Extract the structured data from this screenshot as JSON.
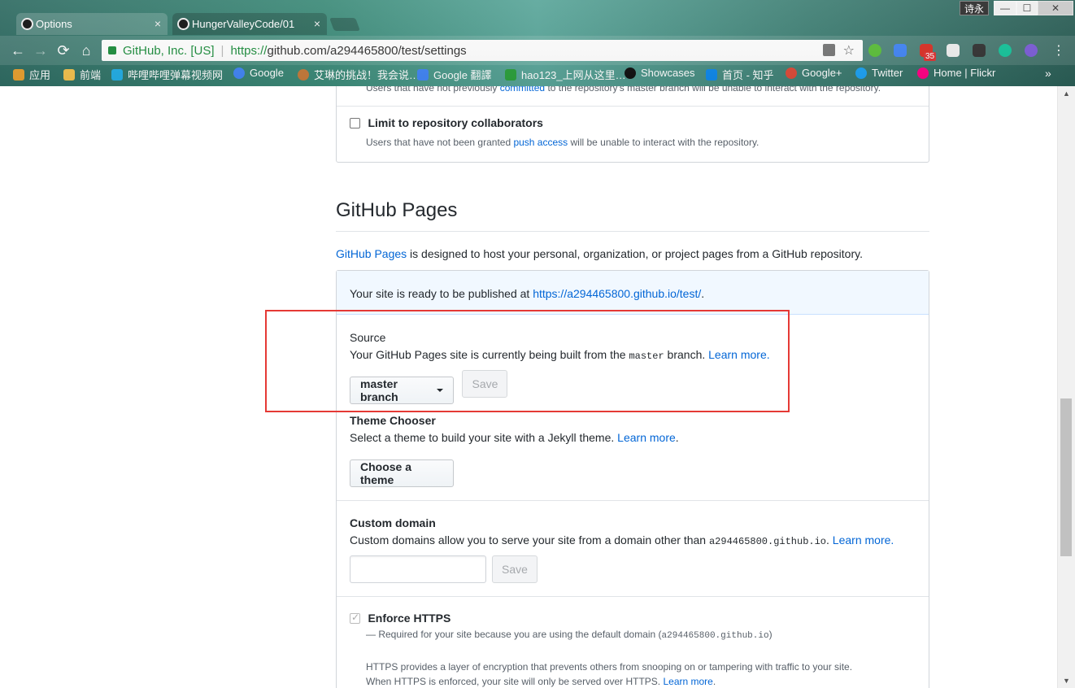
{
  "browser": {
    "tabs": [
      {
        "title": "Options",
        "active": true
      },
      {
        "title": "HungerValleyCode/01",
        "active": false
      }
    ],
    "user_badge": "诗永",
    "window_controls": {
      "minimize": "—",
      "maximize": "☐",
      "close": "✕"
    },
    "nav": {
      "back": "←",
      "forward": "→",
      "reload": "⟳",
      "home": "⌂"
    },
    "address": {
      "site_identity": "GitHub, Inc. [US]",
      "separator": "|",
      "url_protocol": "https://",
      "url_rest": "github.com/a294465800/test/settings"
    },
    "gmail_count": "35",
    "menu": "⋮",
    "bookmarks": [
      {
        "label": "应用",
        "icon": "apps-grid-icon",
        "color": "#e8a030"
      },
      {
        "label": "前端",
        "icon": "folder-icon",
        "color": "#f2c14e"
      },
      {
        "label": "哔哩哔哩弹幕视频网",
        "icon": "bilibili-icon",
        "color": "#23ade5"
      },
      {
        "label": "Google",
        "icon": "google-icon",
        "color": "#4285f4"
      },
      {
        "label": "艾琳的挑战！我会说…",
        "icon": "avatar-icon",
        "color": "#c47a3a"
      },
      {
        "label": "Google 翻譯",
        "icon": "google-translate-icon",
        "color": "#4285f4"
      },
      {
        "label": "hao123_上网从这里…",
        "icon": "hao123-icon",
        "color": "#2ca03c"
      },
      {
        "label": "Showcases",
        "icon": "github-icon",
        "color": "#111111"
      },
      {
        "label": "首页 - 知乎",
        "icon": "zhihu-icon",
        "color": "#0f88eb"
      },
      {
        "label": "Google+",
        "icon": "google-plus-icon",
        "color": "#dd4b39"
      },
      {
        "label": "Twitter",
        "icon": "twitter-icon",
        "color": "#1da1f2"
      },
      {
        "label": "Home | Flickr",
        "icon": "flickr-icon",
        "color": "#ff0084"
      }
    ],
    "bookmarks_more": "»"
  },
  "page": {
    "top_partial_note": {
      "prefix": "Users that have not previously ",
      "link": "committed",
      "suffix": " to the repository's master branch will be unable to interact with the repository."
    },
    "limit_collaborators": {
      "label": "Limit to repository collaborators",
      "note_prefix": "Users that have not been granted ",
      "note_link": "push access",
      "note_suffix": " will be unable to interact with the repository."
    },
    "pages_heading": "GitHub Pages",
    "pages_desc": {
      "link": "GitHub Pages",
      "text": " is designed to host your personal, organization, or project pages from a GitHub repository."
    },
    "flash": {
      "prefix": "Your site is ready to be published at ",
      "url": "https://a294465800.github.io/test/",
      "suffix": "."
    },
    "source": {
      "title": "Source",
      "desc_prefix": "Your GitHub Pages site is currently being built from the ",
      "desc_code": "master",
      "desc_suffix": " branch. ",
      "learn_more": "Learn more",
      "period": ".",
      "branch_button": "master branch",
      "save": "Save"
    },
    "theme": {
      "title": "Theme Chooser",
      "desc": "Select a theme to build your site with a Jekyll theme. ",
      "learn_more": "Learn more",
      "period": ".",
      "button": "Choose a theme"
    },
    "custom_domain": {
      "title": "Custom domain",
      "desc_prefix": "Custom domains allow you to serve your site from a domain other than ",
      "desc_code": "a294465800.github.io",
      "desc_suffix": ". ",
      "learn_more": "Learn more",
      "period": ".",
      "input_value": "",
      "save": "Save"
    },
    "https": {
      "label": "Enforce HTTPS",
      "checked": true,
      "required_prefix": "— Required for your site because you are using the default domain (",
      "required_code": "a294465800.github.io",
      "required_suffix": ")",
      "note1": "HTTPS provides a layer of encryption that prevents others from snooping on or tampering with traffic to your site.",
      "note2_prefix": "When HTTPS is enforced, your site will only be served over HTTPS. ",
      "note2_link": "Learn more",
      "note2_suffix": "."
    }
  },
  "scrollbar": {
    "up": "▲",
    "down": "▼"
  },
  "colors": {
    "link": "#0366d6",
    "highlight": "#e53935",
    "flash_bg": "#f1f8ff"
  }
}
